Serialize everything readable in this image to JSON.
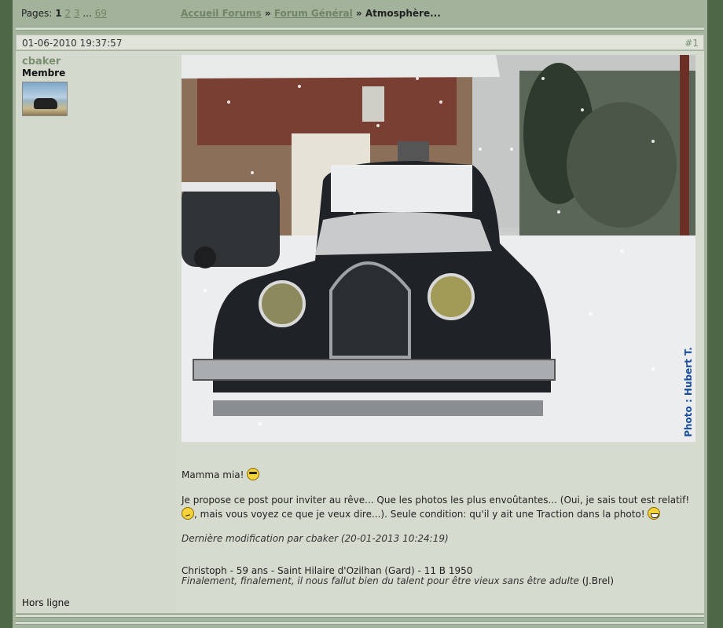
{
  "pagination": {
    "label": "Pages:",
    "current": "1",
    "links": [
      "2",
      "3"
    ],
    "ellipsis": "...",
    "last": "69"
  },
  "breadcrumb": {
    "items": [
      "Accueil Forums",
      "Forum Général"
    ],
    "separator": "»",
    "current": "Atmosphère..."
  },
  "post": {
    "date": "01-06-2010 19:37:57",
    "number": "#1",
    "author": {
      "username": "cbaker",
      "role": "Membre",
      "status": "Hors ligne"
    },
    "photo_credit": "Photo : Hubert T.",
    "line1": "Mamma mia!",
    "para_part1": "Je propose ce post pour inviter au rêve... Que les photos les plus envoûtantes... (Oui, je sais tout est relatif!",
    "para_part2": ", mais vous voyez ce que je veux dire...). Seule condition: qu'il y ait une Traction dans la photo!",
    "edited": "Dernière modification par cbaker (20-01-2013 10:24:19)",
    "signature_line": "Christoph - 59 ans - Saint Hilaire d'Ozilhan (Gard) - 11 B 1950",
    "signature_quote": "Finalement, finalement, il nous fallut bien du talent pour être vieux sans être adulte",
    "signature_quote_author": "(J.Brel)"
  },
  "icons": [
    "cool-smiley-icon",
    "confused-smiley-icon",
    "grin-smiley-icon"
  ],
  "colors": {
    "background": "#4e6847",
    "page": "#a5b59d",
    "link": "#6f8566",
    "username": "#7b9072",
    "credit": "#1a4fa0"
  }
}
